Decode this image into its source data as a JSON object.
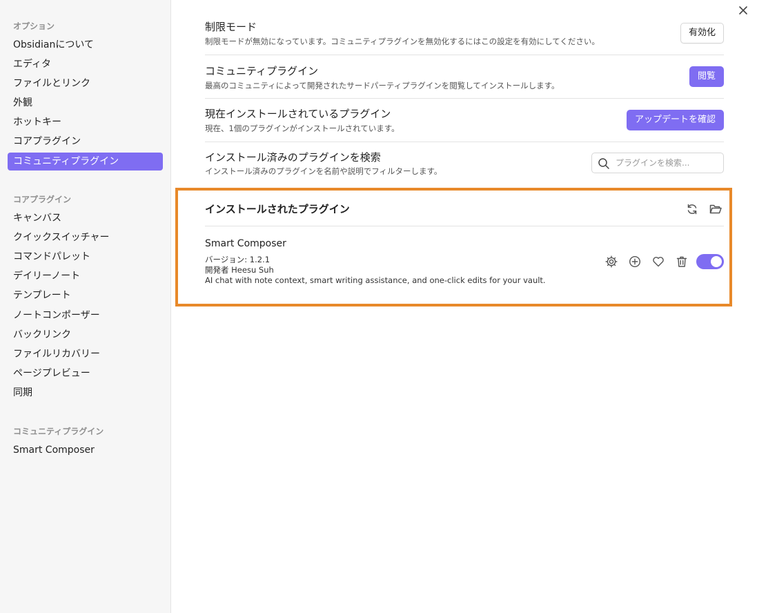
{
  "sidebar": {
    "sections": [
      {
        "heading": "オプション",
        "items": [
          "Obsidianについて",
          "エディタ",
          "ファイルとリンク",
          "外観",
          "ホットキー",
          "コアプラグイン",
          "コミュニティプラグイン"
        ]
      },
      {
        "heading": "コアプラグイン",
        "items": [
          "キャンバス",
          "クイックスイッチャー",
          "コマンドパレット",
          "デイリーノート",
          "テンプレート",
          "ノートコンポーザー",
          "バックリンク",
          "ファイルリカバリー",
          "ページプレビュー",
          "同期"
        ]
      },
      {
        "heading": "コミュニティプラグイン",
        "items": [
          "Smart Composer"
        ]
      }
    ],
    "active_item": "コミュニティプラグイン"
  },
  "settings": {
    "restricted": {
      "name": "制限モード",
      "desc": "制限モードが無効になっています。コミュニティプラグインを無効化するにはこの設定を有効にしてください。",
      "button": "有効化"
    },
    "community": {
      "name": "コミュニティプラグイン",
      "desc": "最高のコミュニティによって開発されたサードパーティプラグインを閲覧してインストールします。",
      "button": "閲覧"
    },
    "installed": {
      "name": "現在インストールされているプラグイン",
      "desc": "現在、1個のプラグインがインストールされています。",
      "button": "アップデートを確認"
    },
    "search": {
      "name": "インストール済みのプラグインを検索",
      "desc": "インストール済みのプラグインを名前や説明でフィルターします。",
      "placeholder": "プラグインを検索..."
    }
  },
  "installed_section": {
    "title": "インストールされたプラグイン",
    "plugin": {
      "name": "Smart Composer",
      "version": "バージョン: 1.2.1",
      "author": "開発者 Heesu Suh",
      "description": "AI chat with note context, smart writing assistance, and one-click edits for your vault.",
      "enabled": true
    }
  },
  "colors": {
    "accent": "#7f6df2",
    "highlight": "#e8892a"
  },
  "icons": [
    "close-icon",
    "search-icon",
    "refresh-icon",
    "folder-icon",
    "gear-icon",
    "plus-circle-icon",
    "heart-icon",
    "trash-icon"
  ]
}
